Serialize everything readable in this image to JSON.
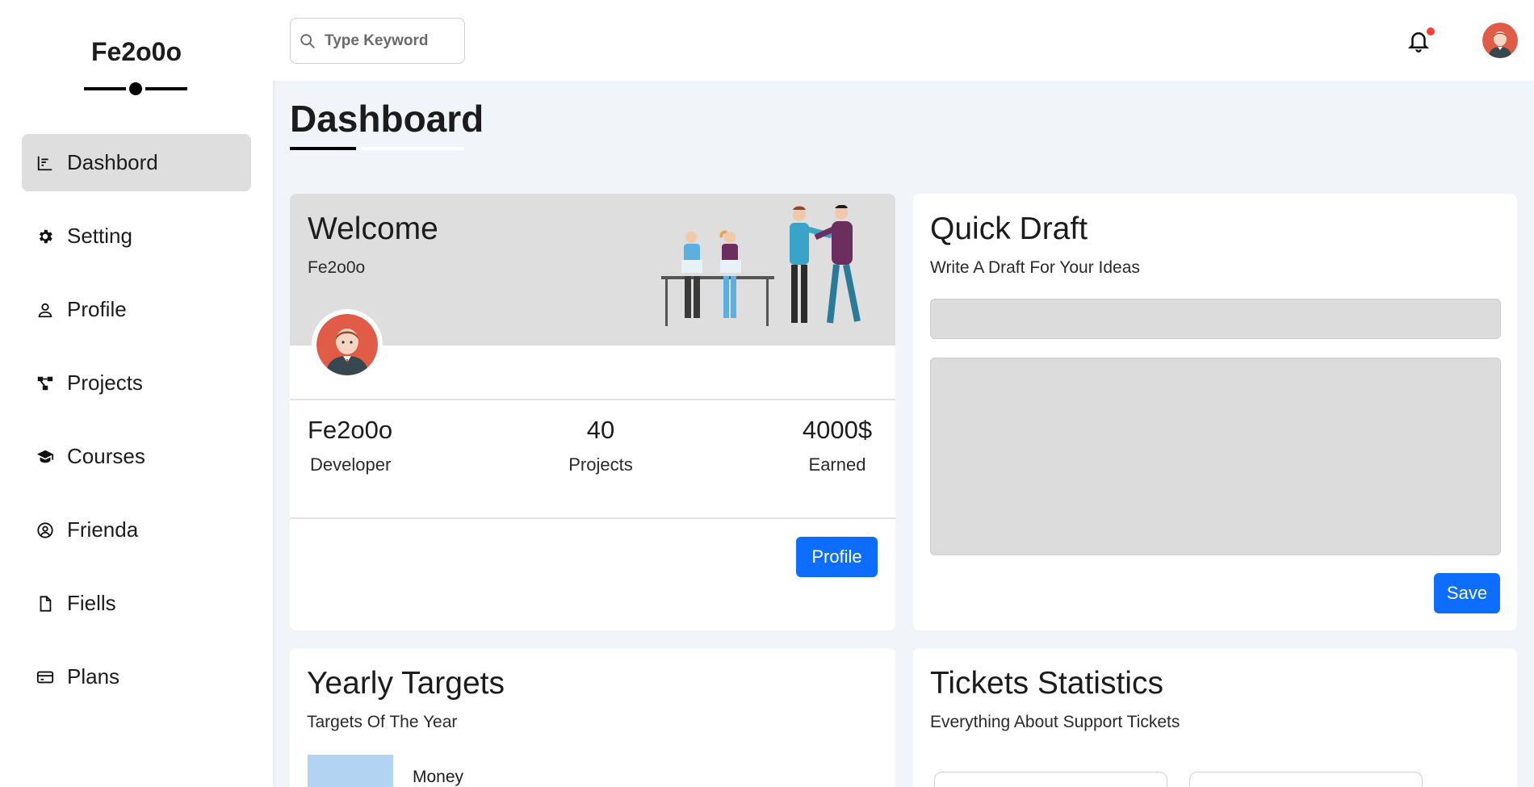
{
  "sidebar": {
    "brand": "Fe2o0o",
    "items": [
      {
        "label": "Dashbord",
        "icon": "chart-icon",
        "active": true
      },
      {
        "label": "Setting",
        "icon": "gear-icon"
      },
      {
        "label": "Profile",
        "icon": "user-icon"
      },
      {
        "label": "Projects",
        "icon": "diagram-icon"
      },
      {
        "label": "Courses",
        "icon": "graduation-cap-icon"
      },
      {
        "label": "Frienda",
        "icon": "user-circle-icon"
      },
      {
        "label": "Fiells",
        "icon": "file-icon"
      },
      {
        "label": "Plans",
        "icon": "credit-card-icon"
      }
    ]
  },
  "topbar": {
    "search_placeholder": "Type Keyword",
    "notification_icon": "bell-icon",
    "badge_color": "#f44336"
  },
  "page": {
    "title": "Dashboard"
  },
  "welcome": {
    "title": "Welcome",
    "name": "Fe2o0o",
    "stats": [
      {
        "value": "Fe2o0o",
        "label": "Developer"
      },
      {
        "value": "40",
        "label": "Projects"
      },
      {
        "value": "4000$",
        "label": "Earned"
      }
    ],
    "button": "Profile"
  },
  "draft": {
    "title": "Quick Draft",
    "subtitle": "Write A Draft For Your Ideas",
    "button": "Save"
  },
  "yearly": {
    "title": "Yearly Targets",
    "subtitle": "Targets Of The Year",
    "first_target": "Money"
  },
  "tickets": {
    "title": "Tickets Statistics",
    "subtitle": "Everything About Support Tickets"
  },
  "colors": {
    "accent": "#0d6efd",
    "page_bg": "#f1f5f9",
    "header_gray": "#dedede",
    "money_target": "#b2d3f1"
  }
}
